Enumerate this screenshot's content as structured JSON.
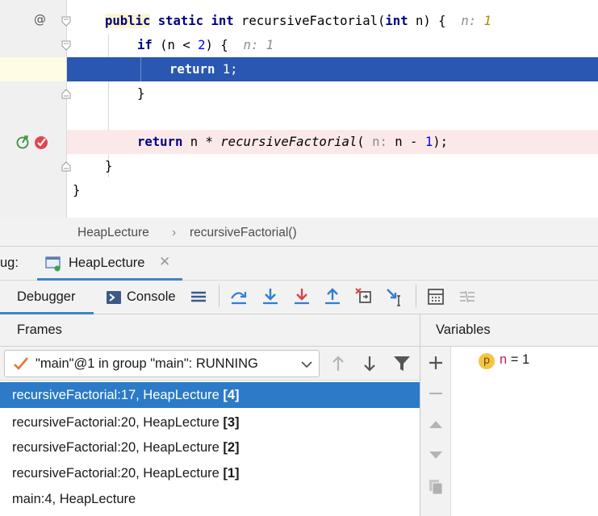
{
  "editor": {
    "line1": {
      "public_kw": "public",
      "static_kw": "static",
      "int_kw": "int",
      "method": "recursiveFactorial",
      "open_paren": "(",
      "param_type": "int",
      "param": "n",
      "close": ") {",
      "hint_name": "n:",
      "hint_value": "1"
    },
    "line2": {
      "if_kw": "if",
      "cond_start": "(n < ",
      "num": "2",
      "cond_end": ") {",
      "hint": "n: 1"
    },
    "line3": {
      "return_kw": "return",
      "num": "1",
      "semi": ";"
    },
    "line4": {
      "brace": "}"
    },
    "line6": {
      "return_kw": "return",
      "expr": "n * ",
      "call": "recursiveFactorial",
      "open": "(",
      "param_hint": "n:",
      "arg": " n - ",
      "num": "1",
      "close": ");"
    },
    "line7": {
      "brace": "}"
    },
    "line8": {
      "brace": "}"
    },
    "gutter": {
      "implements_marker": "@"
    },
    "colors": {
      "exec_line": "#2a57b1",
      "breakpoint_line": "#fbe9e9",
      "breakpoint_icon": "#e0474c"
    }
  },
  "breadcrumb": {
    "class_name": "HeapLecture",
    "separator": "›",
    "method_name": "recursiveFactorial()"
  },
  "debug": {
    "label": "ug:",
    "session_tab": "HeapLecture",
    "tabs": {
      "debugger": "Debugger",
      "console": "Console"
    },
    "toolbar_icons": [
      "layout-icon",
      "step-over-icon",
      "step-into-icon",
      "force-step-into-icon",
      "step-out-icon",
      "drop-frame-icon",
      "run-to-cursor-icon",
      "evaluate-expression-icon",
      "trace-stream-icon"
    ],
    "frames": {
      "header": "Frames",
      "thread": "\"main\"@1 in group \"main\": RUNNING",
      "items": [
        {
          "text": "recursiveFactorial:17, HeapLecture ",
          "index": "[4]",
          "selected": true
        },
        {
          "text": "recursiveFactorial:20, HeapLecture ",
          "index": "[3]",
          "selected": false
        },
        {
          "text": "recursiveFactorial:20, HeapLecture ",
          "index": "[2]",
          "selected": false
        },
        {
          "text": "recursiveFactorial:20, HeapLecture ",
          "index": "[1]",
          "selected": false
        },
        {
          "text": "main:4, HeapLecture",
          "index": "",
          "selected": false
        }
      ]
    },
    "variables": {
      "header": "Variables",
      "items": [
        {
          "badge": "p",
          "name": "n",
          "eq": " = ",
          "value": "1"
        }
      ]
    },
    "colors": {
      "selection": "#2c7ac8",
      "tab_underline": "#4083c9",
      "variable_name": "#c2185b",
      "param_badge": "#f4c542"
    }
  }
}
